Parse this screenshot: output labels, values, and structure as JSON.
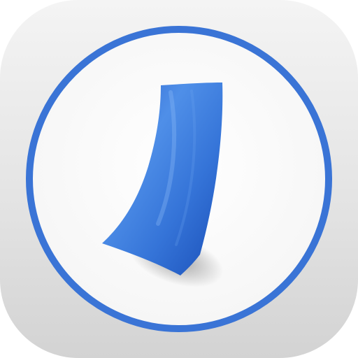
{
  "app_icon": {
    "icon": "curled-blue-paper-sheet-icon",
    "colors": {
      "background_top": "#f4f4f4",
      "background_bottom": "#d3d3d3",
      "ring": "#3a74d6",
      "disc": "#ffffff",
      "sheet_light": "#4f8fe8",
      "sheet_dark": "#1a4fb8"
    }
  }
}
